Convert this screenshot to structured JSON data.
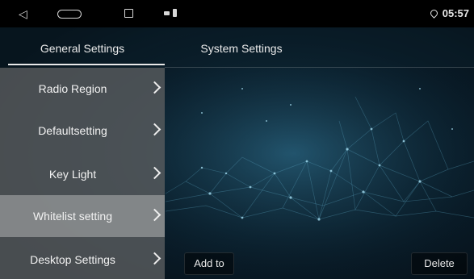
{
  "statusbar": {
    "time": "05:57",
    "icons": [
      "back-icon",
      "home-icon",
      "recents-icon",
      "notification-icon",
      "battery-icon",
      "location-icon"
    ]
  },
  "tabs": [
    {
      "label": "General Settings",
      "active": true
    },
    {
      "label": "System Settings",
      "active": false
    }
  ],
  "menu": [
    {
      "label": "Radio Region",
      "selected": false
    },
    {
      "label": "Defaultsetting",
      "selected": false
    },
    {
      "label": "Key Light",
      "selected": false
    },
    {
      "label": "Whitelist setting",
      "selected": true
    },
    {
      "label": "Desktop Settings",
      "selected": false
    }
  ],
  "buttons": {
    "add": "Add to",
    "delete": "Delete"
  },
  "colors": {
    "sidebar": "#585c5e",
    "selected_item": "#96989a",
    "background": "#0b2231",
    "statusbar": "#000000"
  }
}
